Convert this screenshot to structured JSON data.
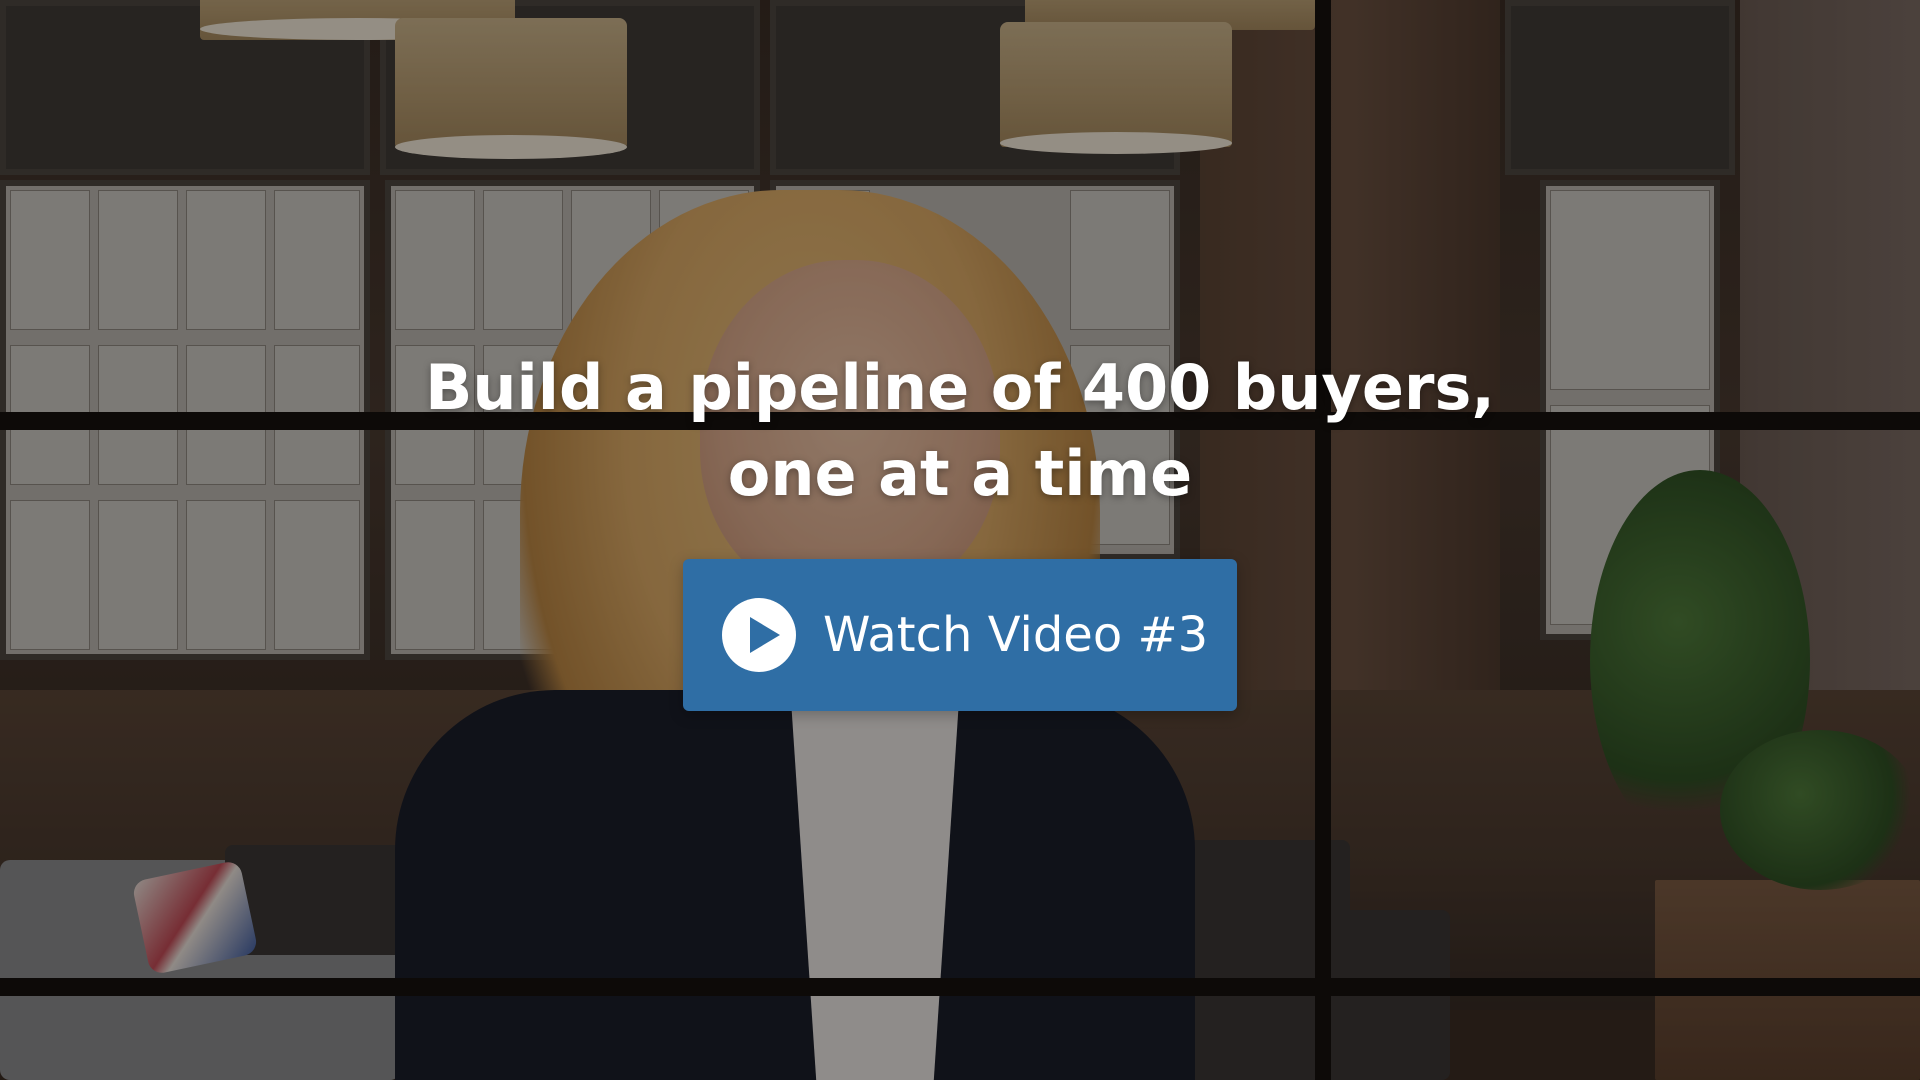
{
  "hero": {
    "headline_line1": "Build a pipeline of 400 buyers,",
    "headline_line2": "one at a time"
  },
  "cta": {
    "label": "Watch Video #3",
    "icon": "play-circle-icon",
    "color": "#2f6ea5"
  }
}
